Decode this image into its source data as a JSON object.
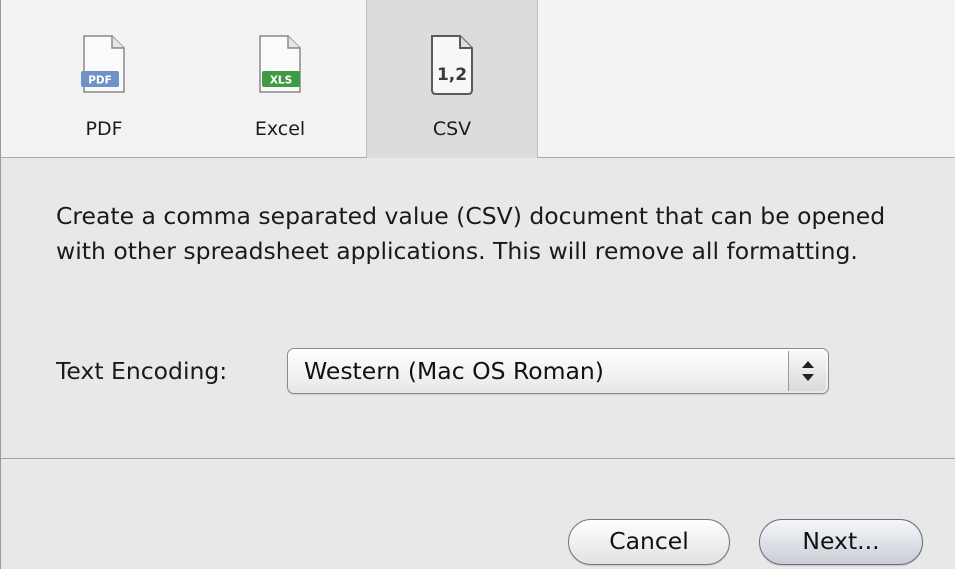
{
  "tabs": [
    {
      "id": "pdf",
      "label": "PDF",
      "icon_text": "PDF",
      "icon": "pdf-document-icon",
      "color": "#6f93c8",
      "selected": false
    },
    {
      "id": "excel",
      "label": "Excel",
      "icon_text": "XLS",
      "icon": "xls-document-icon",
      "color": "#3f9a43",
      "selected": false
    },
    {
      "id": "csv",
      "label": "CSV",
      "icon_text": "1,2",
      "icon": "csv-document-icon",
      "color": "#4a4a4a",
      "selected": true
    }
  ],
  "description": "Create a comma separated value (CSV) document that can be opened with other spreadsheet applications. This will remove all formatting.",
  "encoding": {
    "label": "Text Encoding:",
    "value": "Western (Mac OS Roman)"
  },
  "buttons": {
    "cancel": "Cancel",
    "next": "Next..."
  },
  "colors": {
    "background": "#e8e8e8",
    "tabbar": "#f3f3f3",
    "selected_tab": "#dcdcdc"
  }
}
